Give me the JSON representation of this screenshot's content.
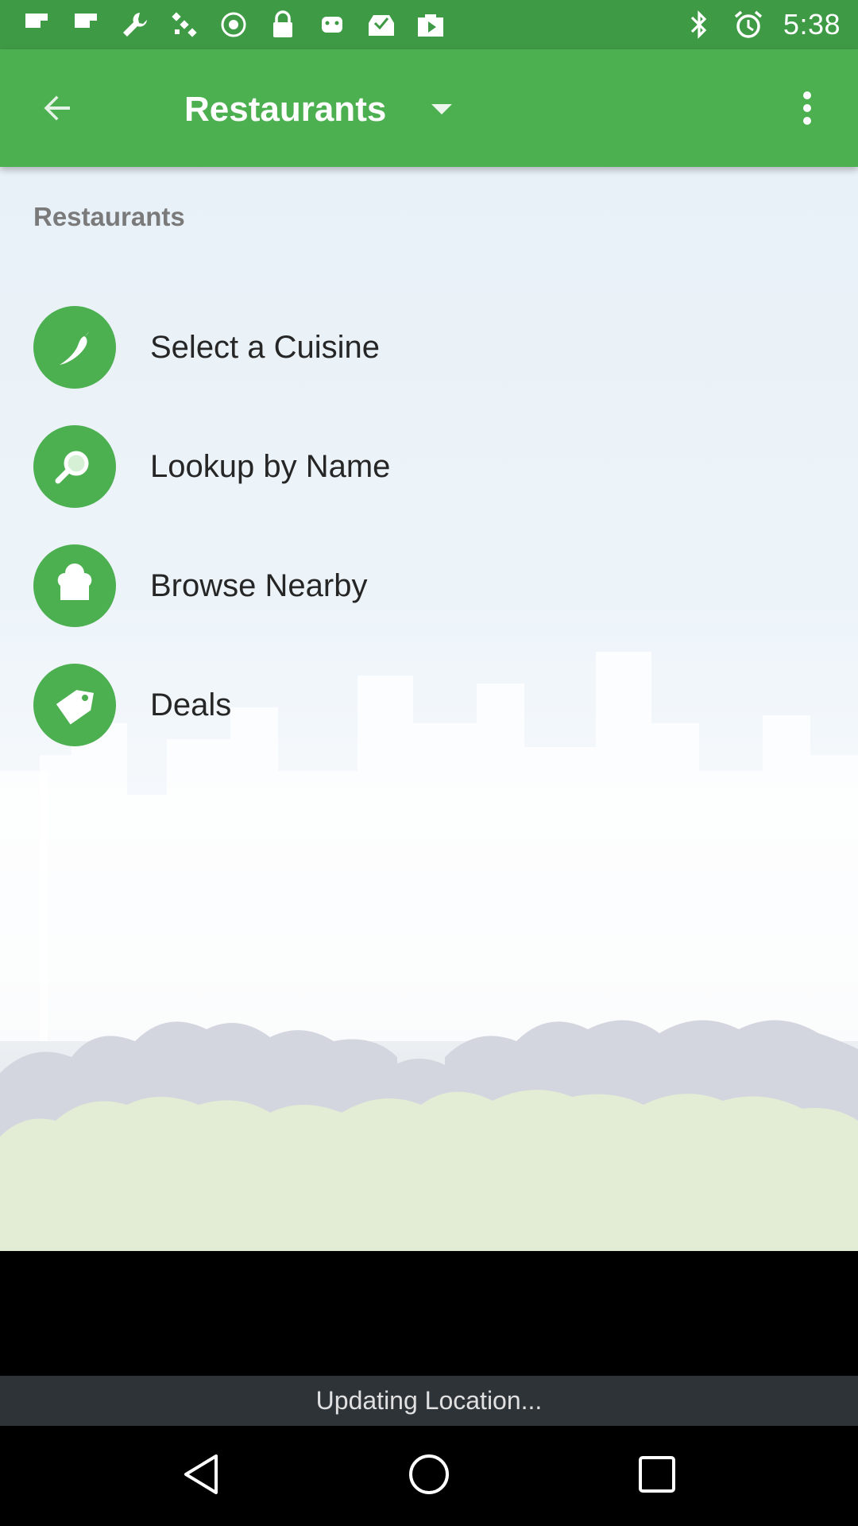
{
  "status_bar": {
    "time": "5:38",
    "left_icons": [
      "flipboard-icon",
      "flipboard-icon",
      "wrench-icon",
      "satellite-icon",
      "circle-dot-icon",
      "lock-icon",
      "android-icon",
      "inbox-check-icon",
      "play-store-icon"
    ],
    "right_icons": [
      "bluetooth-icon",
      "alarm-icon"
    ]
  },
  "app_bar": {
    "title": "Restaurants",
    "back_icon": "arrow-back-icon",
    "dropdown_icon": "triangle-down-icon",
    "overflow_icon": "more-vert-icon"
  },
  "content": {
    "section_title": "Restaurants",
    "menu_items": [
      {
        "label": "Select a Cuisine",
        "icon": "chili-pepper-icon"
      },
      {
        "label": "Lookup by Name",
        "icon": "magnifier-icon"
      },
      {
        "label": "Browse Nearby",
        "icon": "chef-hat-icon"
      },
      {
        "label": "Deals",
        "icon": "price-tag-icon"
      }
    ]
  },
  "update_bar": {
    "text": "Updating Location..."
  },
  "nav_bar": {
    "back_icon": "nav-back-icon",
    "home_icon": "nav-home-icon",
    "recents_icon": "nav-recents-icon"
  },
  "colors": {
    "primary": "#4caf50",
    "status_bar": "#3f9a45",
    "update_bar": "#2e3338"
  }
}
